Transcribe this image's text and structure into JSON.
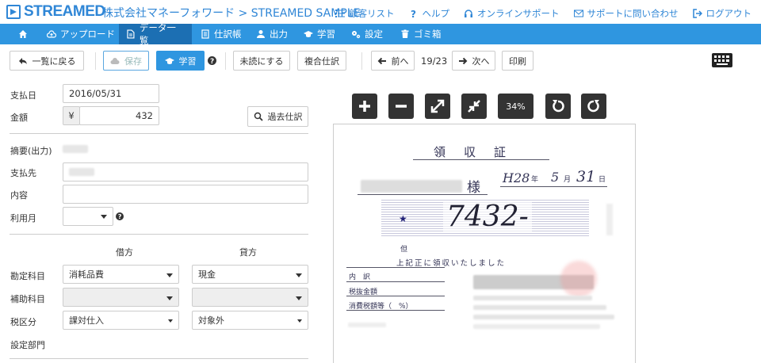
{
  "header": {
    "logo": "STREAMED",
    "company_path": "株式会社マネーフォワード > STREAMED SAMPLE",
    "links": [
      "顧客リスト",
      "ヘルプ",
      "オンラインサポート",
      "サポートに問い合わせ",
      "ログアウト"
    ]
  },
  "nav": {
    "items": [
      "アップロード",
      "データ一覧",
      "仕訳帳",
      "出力",
      "学習",
      "設定",
      "ゴミ箱"
    ],
    "active": "データ一覧"
  },
  "toolbar": {
    "back": "一覧に戻る",
    "save": "保存",
    "learn": "学習",
    "unread": "未読にする",
    "compound": "複合仕訳",
    "prev": "前へ",
    "page": "19/23",
    "next": "次へ",
    "print": "印刷"
  },
  "form": {
    "payment_date_label": "支払日",
    "payment_date": "2016/05/31",
    "amount_label": "金額",
    "currency": "¥",
    "amount": "432",
    "past_entries": "過去仕訳",
    "summary_label": "摘要(出力)",
    "payee_label": "支払先",
    "content_label": "内容",
    "usage_month_label": "利用月",
    "debit_label": "借方",
    "credit_label": "貸方",
    "account_label": "勘定科目",
    "debit_account": "消耗品費",
    "credit_account": "現金",
    "sub_account_label": "補助科目",
    "tax_label": "税区分",
    "debit_tax": "課対仕入",
    "credit_tax": "対象外",
    "department_label": "設定部門"
  },
  "viewer": {
    "zoom": "34%"
  },
  "receipt": {
    "title": "領　収　証",
    "era_year": "H28",
    "year_unit": "年",
    "month": "5",
    "month_unit": "月",
    "day": "31",
    "day_unit": "日",
    "honorific": "様",
    "star": "★",
    "amount": "7432-",
    "tadashi": "但",
    "received_text": "上記正に領収いたしました",
    "breakdown": "内　訳",
    "tax_excluded": "税抜金額",
    "tax_amount": "消費税額等（　%）"
  }
}
